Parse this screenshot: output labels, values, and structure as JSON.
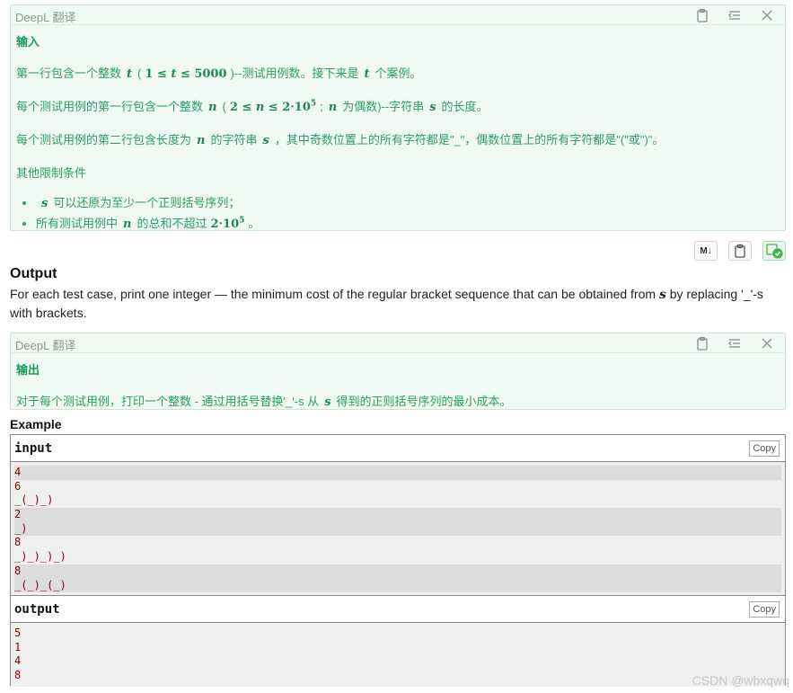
{
  "panel1": {
    "title": "DeepL 翻译",
    "heading": "输入",
    "line1": {
      "pre": "第一行包含一个整数",
      "var": "t",
      "paren_open": "(",
      "cond_a": "1 ≤ ",
      "cond_var": "t",
      "cond_b": " ≤ 5000",
      "post": ")--测试用例数。接下来是",
      "var2": "t",
      "tail": "个案例。"
    },
    "line2": {
      "pre": "每个测试用例的第一行包含一个整数",
      "var": "n",
      "paren_open": "(",
      "cond_a": "2 ≤ ",
      "cond_var": "n",
      "cond_b": " ≤ 2·10",
      "exp": "5",
      "semi": ";",
      "var2": "n",
      "tail": "为偶数)--字符串",
      "var3": "s",
      "end": "的长度。"
    },
    "line3": {
      "pre": "每个测试用例的第二行包含长度为",
      "var": "n",
      "mid": "的字符串",
      "var2": "s",
      "tail": "，其中奇数位置上的所有字符都是\"_\"，偶数位置上的所有字符都是\"(\"或\")\"。"
    },
    "limits_heading": "其他限制条件",
    "bullet1": {
      "var": "s",
      "text": "可以还原为至少一个正则括号序列；"
    },
    "bullet2": {
      "pre": "所有测试用例中",
      "var": "n",
      "mid": "的总和不超过",
      "num": "2·10",
      "exp": "5",
      "end": "。"
    }
  },
  "icons_row": {
    "md_label": "M↓"
  },
  "output_section": {
    "heading": "Output",
    "desc_pre": "For each test case, print one integer — the minimum cost of the regular bracket sequence that can be obtained from ",
    "desc_var": "s",
    "desc_post": " by replacing '_'-s with brackets."
  },
  "panel2": {
    "title": "DeepL 翻译",
    "heading": "输出",
    "line1": {
      "pre": "对于每个测试用例，打印一个整数 - 通过用括号替换'_'-s 从",
      "var": "s",
      "tail": "得到的正则括号序列的最小成本。"
    }
  },
  "example": {
    "heading": "Example",
    "input": {
      "title": "input",
      "copy": "Copy",
      "lines": [
        "4",
        "6",
        "_(_)_)",
        "2",
        "_)",
        "8",
        "_)_)_)_)",
        "8",
        "_(_)_(_)"
      ]
    },
    "output": {
      "title": "output",
      "copy": "Copy",
      "lines": [
        "5",
        "1",
        "4",
        "8"
      ]
    }
  },
  "watermark": "CSDN @wbxqwq"
}
